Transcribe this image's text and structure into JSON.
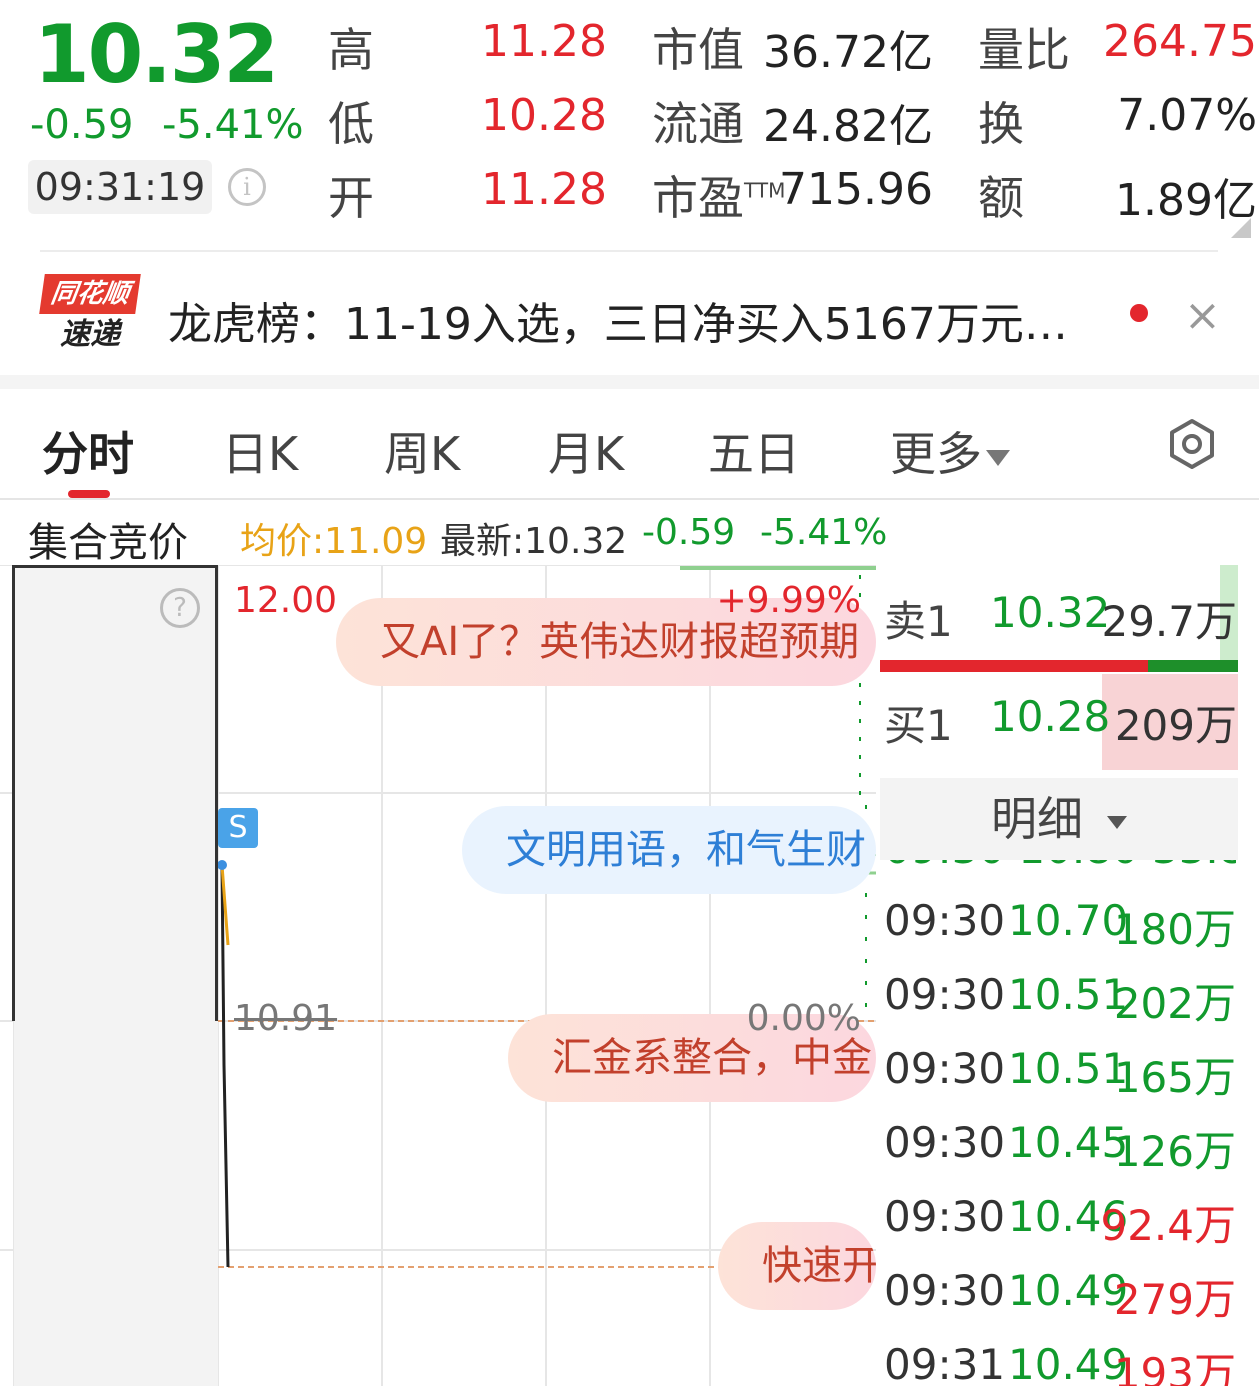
{
  "quote": {
    "price": "10.32",
    "change": "-0.59",
    "change_pct": "-5.41%",
    "time": "09:31:19",
    "high_label": "高",
    "high": "11.28",
    "low_label": "低",
    "low": "10.28",
    "open_label": "开",
    "open": "11.28",
    "mcap_label": "市值",
    "mcap": "36.72亿",
    "float_label": "流通",
    "float": "24.82亿",
    "pe_label": "市盈",
    "pe_sup": "TTM",
    "pe": "715.96",
    "vol_ratio_label": "量比",
    "vol_ratio": "264.75",
    "turnover_label": "换",
    "turnover": "7.07%",
    "amount_label": "额",
    "amount": "1.89亿"
  },
  "news": {
    "logo_top": "同花顺",
    "logo_bottom": "速递",
    "text": "龙虎榜：11-19入选，三日净买入5167万元…",
    "close": "×"
  },
  "tabs": [
    "分时",
    "日K",
    "周K",
    "月K",
    "五日",
    "更多"
  ],
  "chart_header": {
    "auction": "集合竞价",
    "avg_label": "均价:",
    "avg": "11.09",
    "latest_label": "最新:",
    "latest": "10.32",
    "change": "-0.59",
    "change_pct": "-5.41%"
  },
  "chart": {
    "y_top": "12.00",
    "pct_top": "+9.99%",
    "y_mid": "10.91",
    "pct_mid": "0.00%",
    "marker": "S",
    "help": "?",
    "bubbles": [
      "又AI了？英伟达财报超预期",
      "文明用语，和气生财",
      "汇金系整合，中金",
      "快速开"
    ],
    "colors": {
      "up": "#e3262d",
      "down": "#119a2d",
      "avg_line": "#e8a317"
    }
  },
  "orderbook": {
    "ask_label": "卖1",
    "ask_price": "10.32",
    "ask_vol": "29.7万",
    "bid_label": "买1",
    "bid_price": "10.28",
    "bid_vol": "209万",
    "detail_label": "明细"
  },
  "ticks": [
    {
      "time": "09:30",
      "price": "10.70",
      "vol": "180万",
      "dir": "down"
    },
    {
      "time": "09:30",
      "price": "10.51",
      "vol": "202万",
      "dir": "down"
    },
    {
      "time": "09:30",
      "price": "10.51",
      "vol": "165万",
      "dir": "down"
    },
    {
      "time": "09:30",
      "price": "10.45",
      "vol": "126万",
      "dir": "down"
    },
    {
      "time": "09:30",
      "price": "10.46",
      "vol": "92.4万",
      "dir": "up"
    },
    {
      "time": "09:30",
      "price": "10.49",
      "vol": "279万",
      "dir": "up"
    },
    {
      "time": "09:31",
      "price": "10.49",
      "vol": "193万",
      "dir": "up"
    }
  ]
}
